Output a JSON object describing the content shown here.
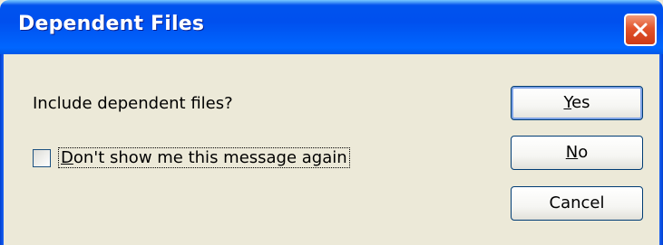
{
  "window": {
    "title": "Dependent Files"
  },
  "dialog": {
    "message": "Include dependent files?",
    "checkbox": {
      "label_first": "D",
      "label_rest": "on't show me this message again",
      "checked": false
    },
    "buttons": {
      "yes": {
        "mnemonic": "Y",
        "rest": "es"
      },
      "no": {
        "mnemonic": "N",
        "rest": "o"
      },
      "cancel": {
        "label": "Cancel"
      }
    }
  },
  "colors": {
    "titlebar": "#0054e3",
    "dialog_bg": "#ece9d8",
    "close_button": "#e2542c"
  },
  "icons": {
    "close": "close-icon"
  }
}
